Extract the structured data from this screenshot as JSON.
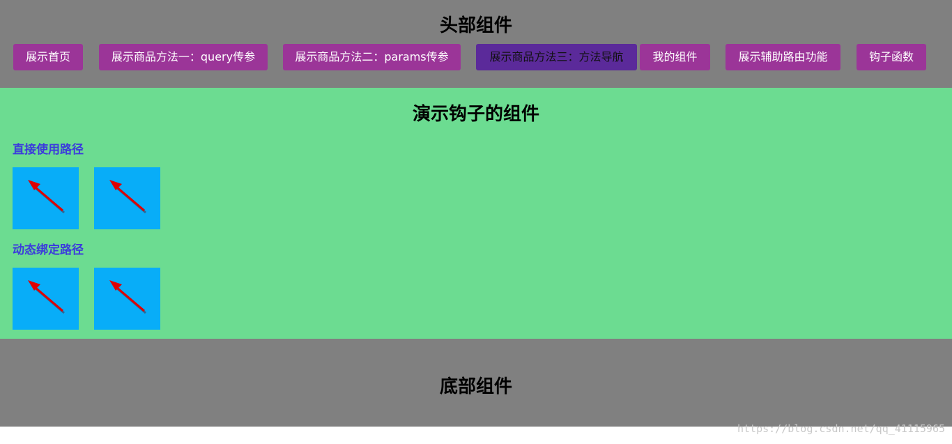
{
  "header": {
    "title": "头部组件",
    "nav": [
      {
        "label": "展示首页",
        "active": false
      },
      {
        "label": "展示商品方法一：query传参",
        "active": false
      },
      {
        "label": "展示商品方法二：params传参",
        "active": false
      },
      {
        "label": "展示商品方法三：方法导航",
        "active": true
      },
      {
        "label": "我的组件",
        "active": false
      },
      {
        "label": "展示辅助路由功能",
        "active": false
      },
      {
        "label": "钩子函数",
        "active": false
      }
    ]
  },
  "main": {
    "title": "演示钩子的组件",
    "sections": [
      {
        "heading": "直接使用路径",
        "images": [
          "arrow-icon",
          "arrow-icon"
        ]
      },
      {
        "heading": "动态绑定路径",
        "images": [
          "arrow-icon",
          "arrow-icon"
        ]
      }
    ]
  },
  "footer": {
    "title": "底部组件"
  },
  "watermark": "https://blog.csdn.net/qq_41115965",
  "colors": {
    "header_bg": "#808080",
    "main_bg": "#6cdc91",
    "nav_button": "#9b3598",
    "nav_button_active": "#5b2a9a",
    "heading_link": "#3b3bdc",
    "image_bg": "#08adf8",
    "arrow": "#e00000"
  }
}
